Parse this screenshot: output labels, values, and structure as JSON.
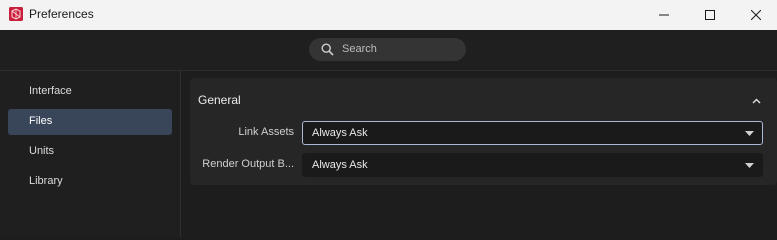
{
  "window": {
    "title": "Preferences"
  },
  "search": {
    "placeholder": "Search"
  },
  "sidebar": {
    "items": [
      {
        "label": "Interface",
        "active": false
      },
      {
        "label": "Files",
        "active": true
      },
      {
        "label": "Units",
        "active": false
      },
      {
        "label": "Library",
        "active": false
      }
    ]
  },
  "main": {
    "section_title": "General",
    "rows": [
      {
        "label": "Link Assets",
        "value": "Always Ask"
      },
      {
        "label": "Render Output B...",
        "value": "Always Ask"
      }
    ]
  },
  "colors": {
    "titlebar_bg": "#f3f3f3",
    "app_bg": "#1d1d1d",
    "panel_bg": "#262626",
    "active_item_bg": "#394558",
    "focus_border": "#a9b9d6",
    "app_icon": "#c8203a"
  },
  "icons": {
    "app": "app-logo-icon",
    "search": "search-icon",
    "collapse": "chevron-up-icon",
    "dropdown": "caret-down-icon"
  }
}
